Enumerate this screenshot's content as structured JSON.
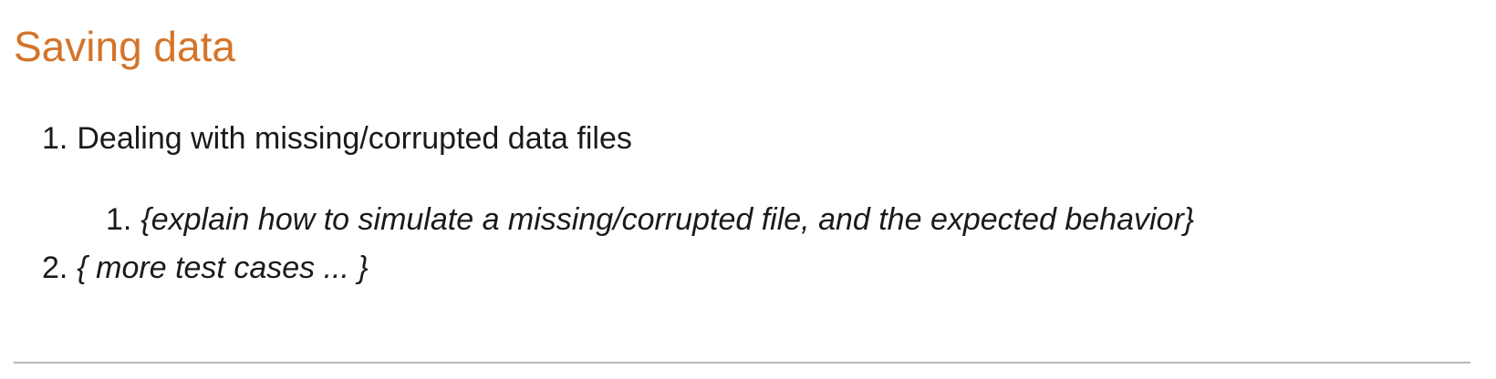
{
  "section": {
    "title": "Saving data"
  },
  "list": {
    "item1": {
      "number": "1.",
      "text": "Dealing with missing/corrupted data files"
    },
    "item1_1": {
      "number": "1.",
      "text": "{explain how to simulate a missing/corrupted file, and the expected behavior}"
    },
    "item2": {
      "number": "2.",
      "text": "{ more test cases ... }"
    }
  }
}
